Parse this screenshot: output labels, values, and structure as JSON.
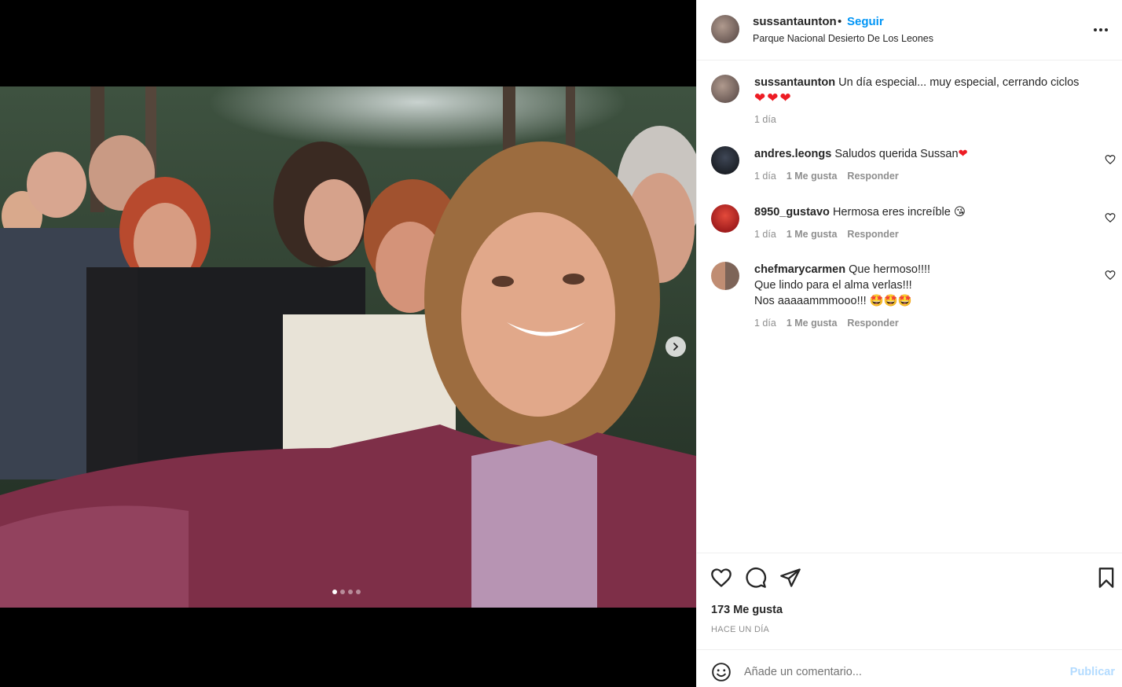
{
  "post": {
    "username": "sussantaunton",
    "separator": "•",
    "follow_label": "Seguir",
    "location": "Parque Nacional Desierto De Los Leones",
    "more_icon": "more-options-icon"
  },
  "caption": {
    "username": "sussantaunton",
    "text": "Un día especial... muy especial, cerrando ciclos",
    "emojis": "❤❤❤",
    "time": "1 día"
  },
  "comments": [
    {
      "username": "andres.leongs",
      "text": "Saludos querida Sussan",
      "emoji": "❤",
      "time": "1 día",
      "likes": "1 Me gusta",
      "reply": "Responder"
    },
    {
      "username": "8950_gustavo",
      "text": "Hermosa eres increíble",
      "emoji": "😘",
      "time": "1 día",
      "likes": "1 Me gusta",
      "reply": "Responder"
    },
    {
      "username": "chefmarycarmen",
      "text": "Que hermoso!!!!",
      "line2": "Que lindo para el alma verlas!!!",
      "line3": "Nos aaaaammmooo!!!",
      "emoji": "🤩🤩🤩",
      "time": "1 día",
      "likes": "1 Me gusta",
      "reply": "Responder"
    }
  ],
  "stats": {
    "likes": "173 Me gusta",
    "time_ago": "HACE UN DÍA"
  },
  "composer": {
    "placeholder": "Añade un comentario...",
    "publish_label": "Publicar"
  },
  "carousel": {
    "slides": 4,
    "active": 1
  },
  "colors": {
    "link_blue": "#0095f6",
    "muted": "#8e8e8e",
    "publish_disabled": "#b3dbff"
  }
}
